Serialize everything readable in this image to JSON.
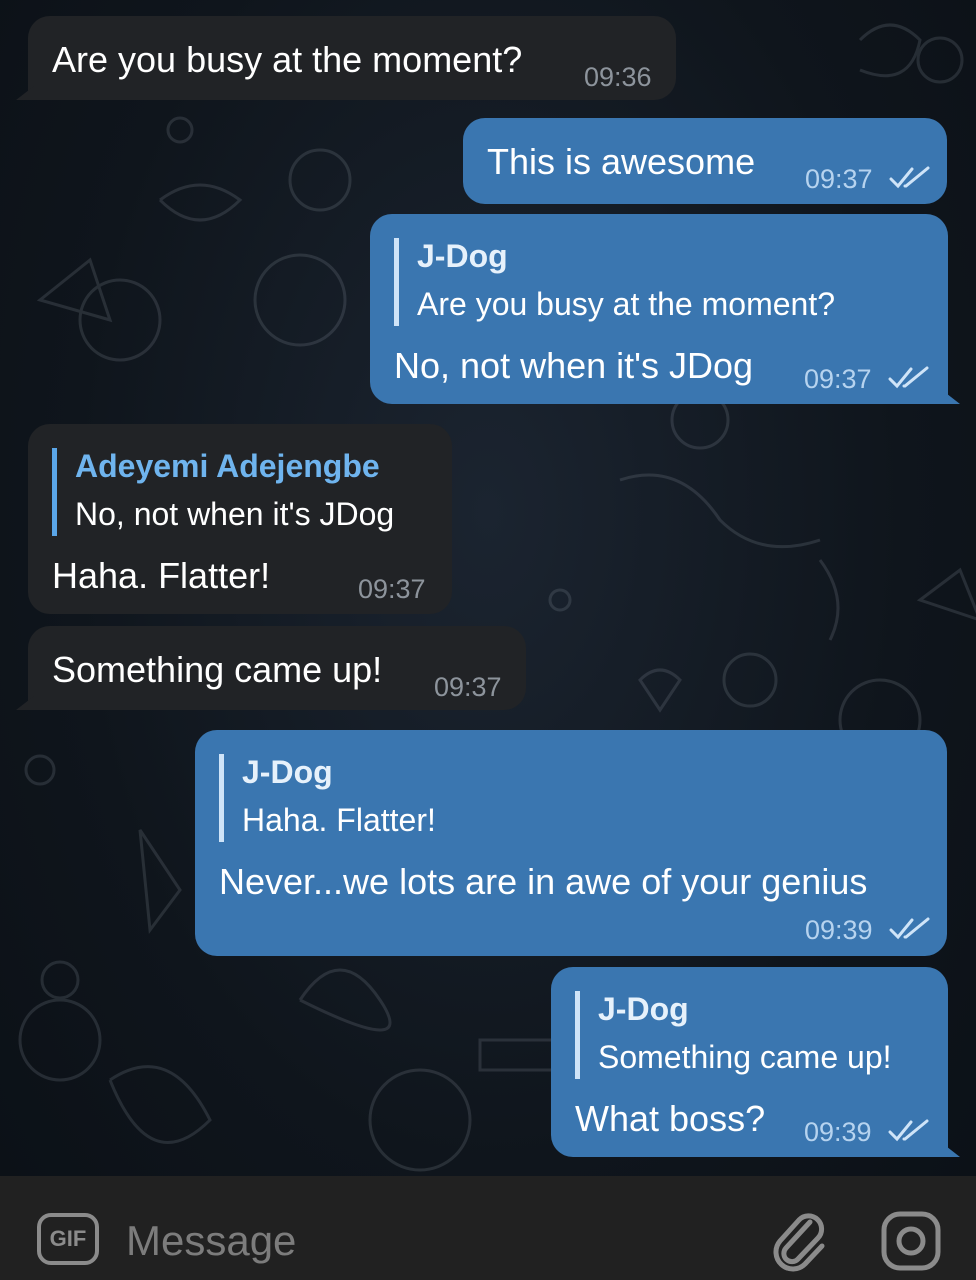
{
  "messages": [
    {
      "text": "Are you busy at the moment?",
      "time": "09:36"
    },
    {
      "text": "This is awesome",
      "time": "09:37"
    },
    {
      "reply_name": "J-Dog",
      "reply_text": "Are you busy at the moment?",
      "text": "No, not when it's JDog",
      "time": "09:37"
    },
    {
      "reply_name": "Adeyemi Adejengbe",
      "reply_text": "No, not when it's JDog",
      "text": "Haha. Flatter!",
      "time": "09:37"
    },
    {
      "text": "Something came up!",
      "time": "09:37"
    },
    {
      "reply_name": "J-Dog",
      "reply_text": "Haha. Flatter!",
      "text": "Never...we lots are in awe of your genius",
      "time": "09:39"
    },
    {
      "reply_name": "J-Dog",
      "reply_text": "Something came up!",
      "text": "What boss?",
      "time": "09:39"
    }
  ],
  "composer": {
    "gif_label": "GIF",
    "placeholder": "Message",
    "icons": [
      "gif-icon",
      "paperclip-icon",
      "camera-icon"
    ]
  },
  "colors": {
    "incoming_bubble": "#212326",
    "outgoing_bubble": "#3a76b0",
    "background": "#0f151c",
    "composer_bar": "#212121"
  }
}
